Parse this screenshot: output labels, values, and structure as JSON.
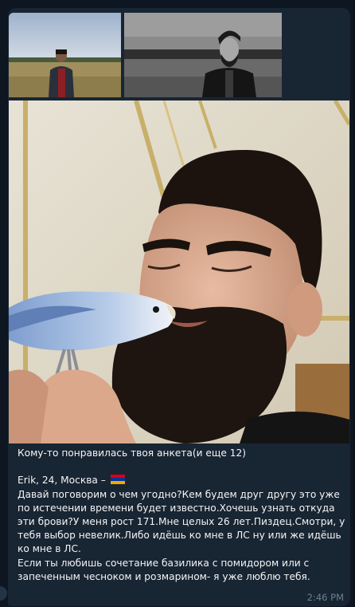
{
  "message": {
    "photos": [
      {
        "name": "photo-1",
        "alt": "man in red shirt on field"
      },
      {
        "name": "photo-2",
        "alt": "man in black jacket black and white"
      },
      {
        "name": "photo-3",
        "alt": "man with blue parrot"
      }
    ],
    "caption": {
      "line1": "Кому-то понравилась твоя анкета(и еще 12)",
      "profile_header": "Erik, 24, Москва –",
      "flag_icon": "armenia-flag-icon",
      "body1": "Давай поговорим о чем угодно?Кем будем друг другу это уже по истечении времени будет известно.Хочешь узнать откуда эти брови?У меня рост 171.Мне целых 26 лет.Пиздец.Смотри, у тебя выбор невелик.Либо идёшь ко мне в ЛС ну или же идёшь ко мне в ЛС.",
      "body2": "Если ты любишь сочетание базилика с помидором или с запеченным чесноком и розмарином- я уже люблю тебя."
    },
    "time": "2:46 PM"
  },
  "colors": {
    "background": "#0e1621",
    "bubble": "#182533",
    "text": "#f5f5f5",
    "time": "#6d7f8f"
  }
}
